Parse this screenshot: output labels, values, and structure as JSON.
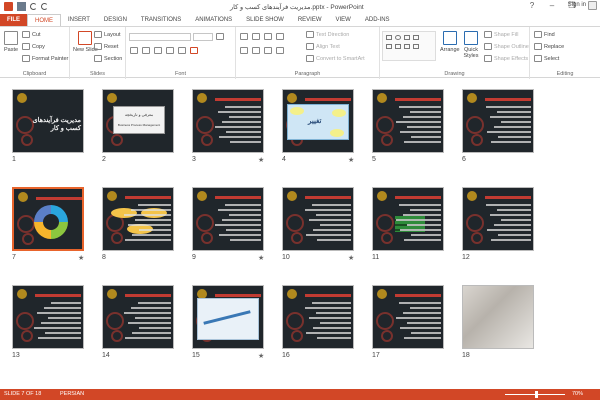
{
  "window": {
    "title": "مدیریت فرآیندهای کسب و کار.pptx - PowerPoint",
    "minimize": "–",
    "restore": "❐",
    "close": "✕",
    "help": "?"
  },
  "tabs": [
    "FILE",
    "HOME",
    "INSERT",
    "DESIGN",
    "TRANSITIONS",
    "ANIMATIONS",
    "SLIDE SHOW",
    "REVIEW",
    "VIEW",
    "ADD-INS"
  ],
  "active_tab": "HOME",
  "signin": "Sign in",
  "ribbon": {
    "clipboard": {
      "label": "Clipboard",
      "paste": "Paste",
      "cut": "Cut",
      "copy": "Copy",
      "format_painter": "Format Painter"
    },
    "slides": {
      "label": "Slides",
      "new_slide": "New Slide",
      "layout": "Layout",
      "reset": "Reset",
      "section": "Section"
    },
    "font": {
      "label": "Font"
    },
    "paragraph": {
      "label": "Paragraph",
      "text_direction": "Text Direction",
      "align_text": "Align Text",
      "convert_smartart": "Convert to SmartArt"
    },
    "drawing": {
      "label": "Drawing",
      "arrange": "Arrange",
      "quick_styles": "Quick Styles",
      "shape_fill": "Shape Fill",
      "shape_outline": "Shape Outline",
      "shape_effects": "Shape Effects"
    },
    "editing": {
      "label": "Editing",
      "find": "Find",
      "replace": "Replace",
      "select": "Select"
    }
  },
  "slides": [
    {
      "n": "1",
      "star": "",
      "kind": "title",
      "text": "مدیریت فرآیندهای کسب و کار"
    },
    {
      "n": "2",
      "star": "",
      "kind": "card",
      "text": "معرفی و تاریخچه",
      "sub": "Business Process Management"
    },
    {
      "n": "3",
      "star": "★",
      "kind": "text"
    },
    {
      "n": "4",
      "star": "★",
      "kind": "diagram",
      "text": "تغییر"
    },
    {
      "n": "5",
      "star": "",
      "kind": "text"
    },
    {
      "n": "6",
      "star": "",
      "kind": "text"
    },
    {
      "n": "7",
      "star": "★",
      "kind": "cycle"
    },
    {
      "n": "8",
      "star": "",
      "kind": "bubbles"
    },
    {
      "n": "9",
      "star": "★",
      "kind": "text"
    },
    {
      "n": "10",
      "star": "★",
      "kind": "text"
    },
    {
      "n": "11",
      "star": "",
      "kind": "green"
    },
    {
      "n": "12",
      "star": "",
      "kind": "text"
    },
    {
      "n": "13",
      "star": "",
      "kind": "text"
    },
    {
      "n": "14",
      "star": "",
      "kind": "text"
    },
    {
      "n": "15",
      "star": "★",
      "kind": "flow"
    },
    {
      "n": "16",
      "star": "",
      "kind": "text"
    },
    {
      "n": "17",
      "star": "",
      "kind": "text"
    },
    {
      "n": "18",
      "star": "",
      "kind": "photo"
    }
  ],
  "selected_slide": "7",
  "status": {
    "slide": "SLIDE 7 OF 18",
    "language": "PERSIAN",
    "zoom": "70%"
  },
  "colors": {
    "accent": "#d24726",
    "thumb_bg": "#20262b",
    "selected": "#e8642c"
  }
}
